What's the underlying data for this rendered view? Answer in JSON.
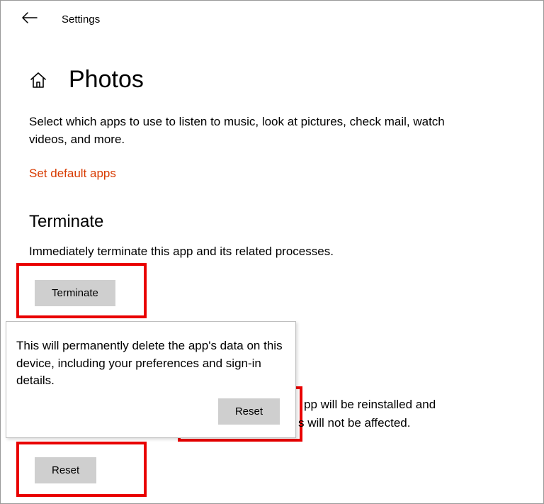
{
  "header": {
    "title": "Settings"
  },
  "page": {
    "title": "Photos",
    "desc": "Select which apps to use to listen to music, look at pictures, check mail, watch videos, and more.",
    "link": "Set default apps"
  },
  "terminate": {
    "heading": "Terminate",
    "desc": "Immediately terminate this app and its related processes.",
    "button": "Terminate"
  },
  "reset": {
    "button": "Reset",
    "bg_line1": "pp will be reinstalled and",
    "bg_line2": "s will not be affected."
  },
  "popup": {
    "text": "This will permanently delete the app's data on this device, including your preferences and sign-in details.",
    "button": "Reset"
  }
}
